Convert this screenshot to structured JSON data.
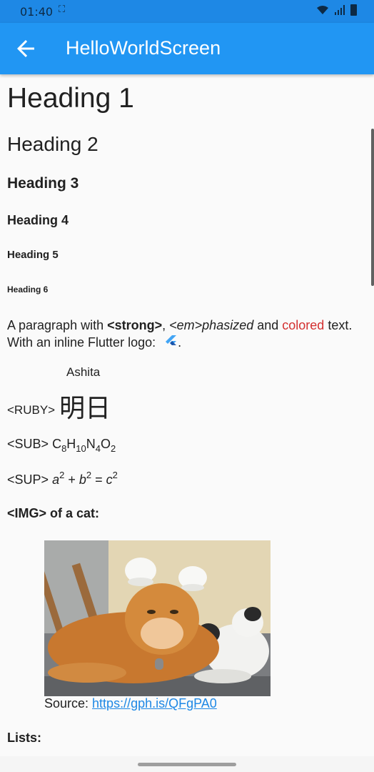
{
  "status_bar": {
    "time": "01:40",
    "cast_indicator": "⛶",
    "icons": [
      "wifi-icon",
      "signal-icon",
      "battery-icon"
    ]
  },
  "app_bar": {
    "title": "HelloWorldScreen",
    "back_icon": "arrow-back-icon",
    "color": "#2196f3"
  },
  "headings": {
    "h1": "Heading 1",
    "h2": "Heading 2",
    "h3": "Heading 3",
    "h4": "Heading 4",
    "h5": "Heading 5",
    "h6": "Heading 6"
  },
  "paragraph": {
    "prefix": "A paragraph with ",
    "strong": "<strong>",
    "comma": ", ",
    "em": "<em>phasized",
    "and": " and ",
    "colored": "colored",
    "line2": " text. With an inline Flutter logo: ",
    "end": ".",
    "colored_color": "#d32f2f"
  },
  "ruby": {
    "annotation": "Ashita",
    "label": "<RUBY>",
    "base": "明日"
  },
  "sub": {
    "label": "<SUB>",
    "c": "C",
    "c_n": "8",
    "h": "H",
    "h_n": "10",
    "n": "N",
    "n_n": "4",
    "o": "O",
    "o_n": "2"
  },
  "sup": {
    "label": "<SUP>",
    "a": "a",
    "a_e": "2",
    "plus": " + ",
    "b": "b",
    "b_e": "2",
    "eq": " = ",
    "c": "c",
    "c_e": "2"
  },
  "image_section": {
    "heading": "<IMG> of a cat:",
    "caption_prefix": "Source: ",
    "link": "https://gph.is/QFgPA0"
  },
  "lists": {
    "heading": "Lists:"
  }
}
